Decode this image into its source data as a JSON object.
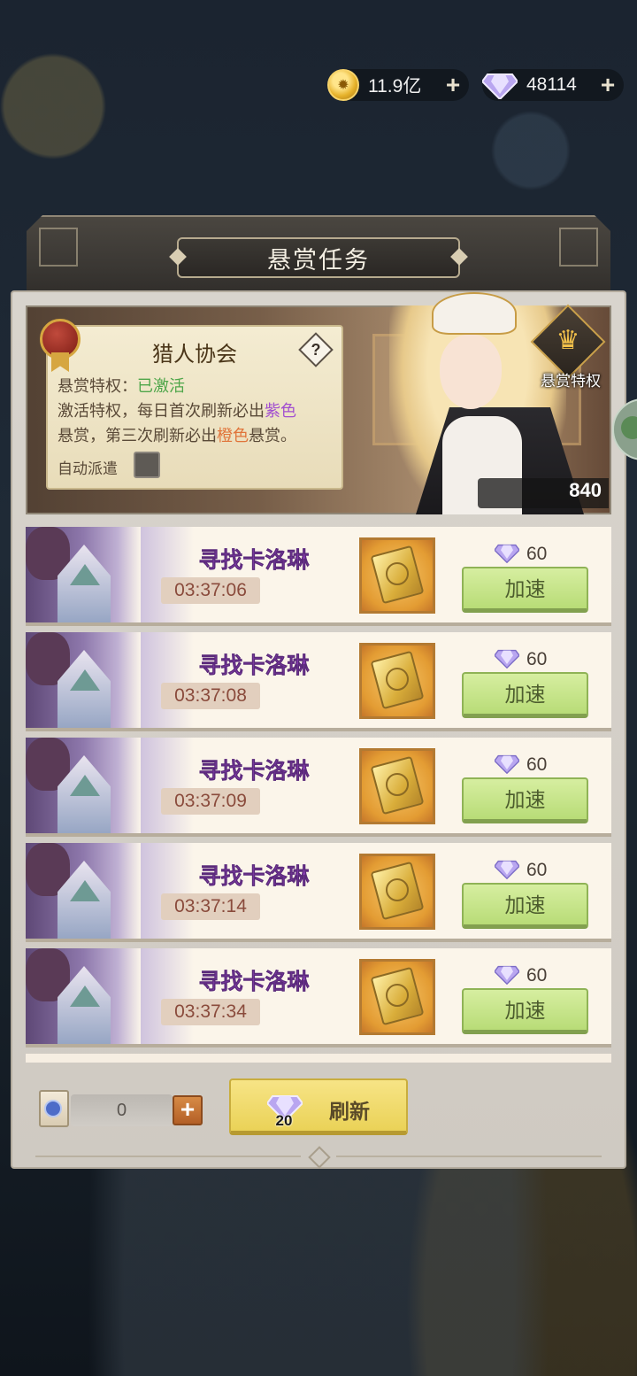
{
  "currency": {
    "gold": {
      "value": "11.9亿"
    },
    "gems": {
      "value": "48114"
    }
  },
  "panel": {
    "title": "悬赏任务"
  },
  "guild": {
    "name": "猎人协会",
    "privilege_label": "悬赏特权：",
    "privilege_status": "已激活",
    "desc_line1_pre": "激活特权，每日首次刷新必出",
    "desc_line1_highlight": "紫色",
    "desc_line2_pre": "悬赏，第三次刷新必出",
    "desc_line2_highlight": "橙色",
    "desc_line2_post": "悬赏。",
    "auto_dispatch_label": "自动派遣",
    "auto_dispatch_checked": false,
    "help_icon": "?"
  },
  "privilege_badge": {
    "label": "悬赏特权",
    "icon": "crown-icon"
  },
  "score": "840",
  "tasks": [
    {
      "name": "寻找卡洛琳",
      "timer": "03:37:06",
      "cost": "60",
      "button": "加速"
    },
    {
      "name": "寻找卡洛琳",
      "timer": "03:37:08",
      "cost": "60",
      "button": "加速"
    },
    {
      "name": "寻找卡洛琳",
      "timer": "03:37:09",
      "cost": "60",
      "button": "加速"
    },
    {
      "name": "寻找卡洛琳",
      "timer": "03:37:14",
      "cost": "60",
      "button": "加速"
    },
    {
      "name": "寻找卡洛琳",
      "timer": "03:37:34",
      "cost": "60",
      "button": "加速"
    }
  ],
  "footer": {
    "scroll_count": "0",
    "refresh_cost": "20",
    "refresh_label": "刷新"
  },
  "colors": {
    "accent_purple": "#a24fd0",
    "accent_orange": "#e0743a",
    "status_green": "#4fa64a",
    "speed_button": "#c6e48a",
    "refresh_button": "#f0da6c"
  }
}
